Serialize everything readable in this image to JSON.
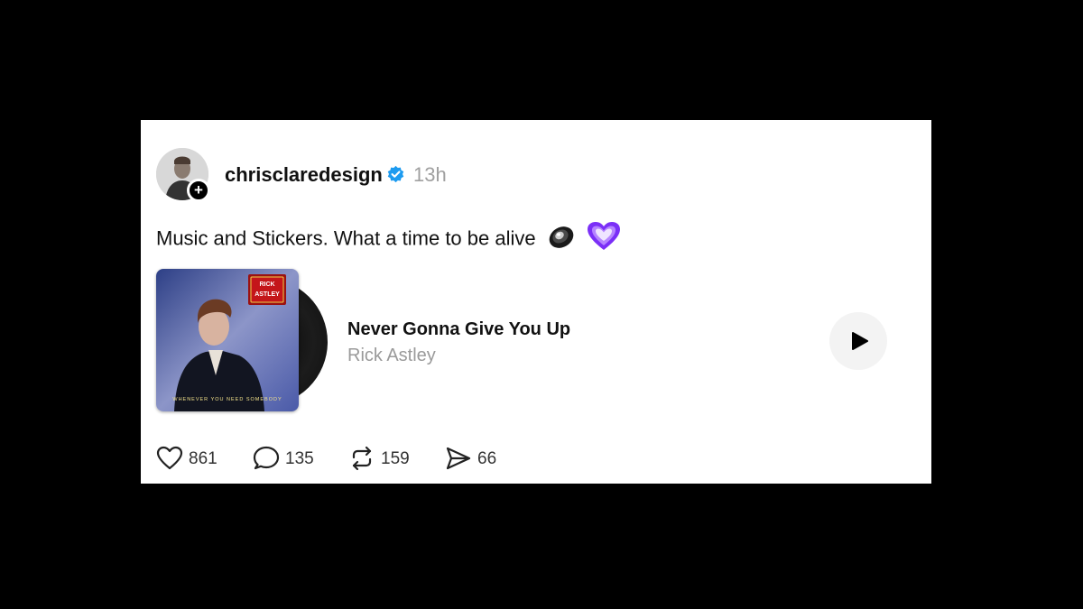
{
  "post": {
    "username": "chrisclaredesign",
    "timestamp": "13h",
    "text": "Music and Stickers. What a time to be alive",
    "stickers": [
      "speaker-icon",
      "purple-heart-icon"
    ],
    "follow_badge": "+"
  },
  "music": {
    "title": "Never Gonna Give You Up",
    "artist": "Rick Astley",
    "album_badge_text": "RICK ASTLEY",
    "album_caption": "WHENEVER YOU NEED SOMEBODY"
  },
  "actions": {
    "likes": "861",
    "replies": "135",
    "reposts": "159",
    "shares": "66"
  },
  "colors": {
    "background": "#000000",
    "card": "#ffffff",
    "verified": "#1d9bf0",
    "muted": "#a0a0a0"
  }
}
